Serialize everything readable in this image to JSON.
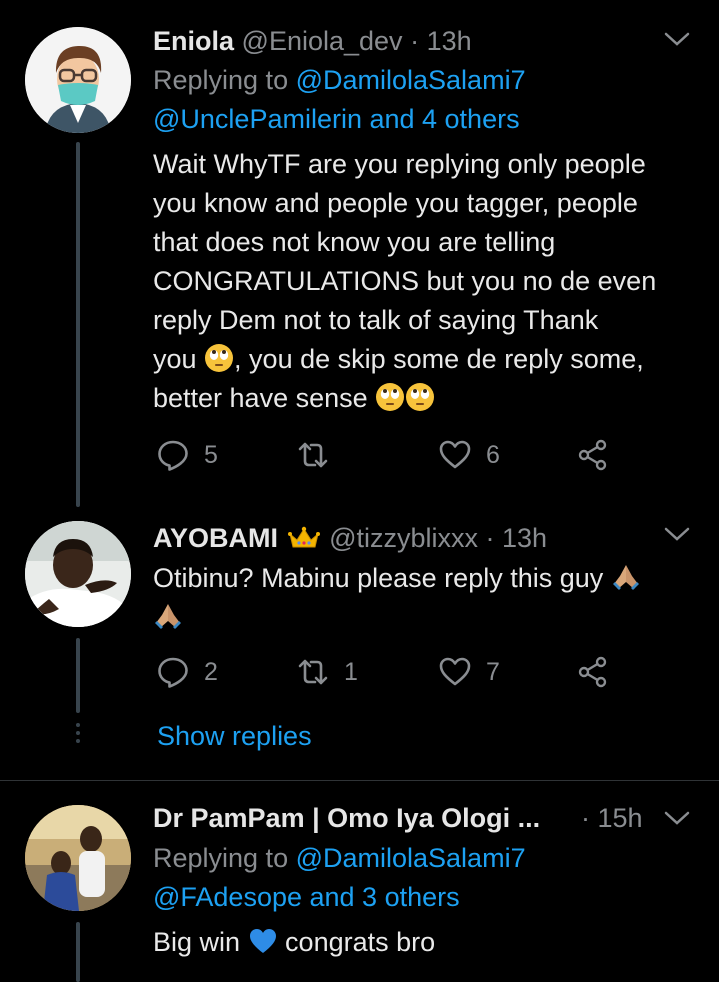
{
  "tweets": [
    {
      "name": "Eniola",
      "handle": "@Eniola_dev",
      "sep": "·",
      "time": "13h",
      "replying_prefix": "Replying to ",
      "replying_user": "@DamilolaSalami7",
      "replying_line2": "@UnclePamilerin and 4 others",
      "lines": [
        "Wait WhyTF are you replying only people",
        "you know and people you tagger, people",
        "that does not know you are telling",
        "CONGRATULATIONS but you no de even",
        "reply Dem not to talk of saying Thank"
      ],
      "line6a": "you ",
      "line6b": ", you de skip some de reply some,",
      "line7": "better have sense ",
      "replies": "5",
      "retweets": "",
      "likes": "6"
    },
    {
      "name": "AYOBAMI",
      "handle": "@tizzyblixxx",
      "sep": "·",
      "time": "13h",
      "text": "Otibinu? Mabinu please reply this guy ",
      "replies": "2",
      "retweets": "1",
      "likes": "7",
      "show_replies": "Show replies"
    },
    {
      "name": "Dr PamPam | Omo Iya Ologi ...",
      "sep": "·",
      "time": "15h",
      "replying_prefix": "Replying to ",
      "replying_user": "@DamilolaSalami7",
      "replying_line2": "@FAdesope and 3 others",
      "text_a": "Big win ",
      "text_b": " congrats bro"
    }
  ],
  "icons": {
    "reply": "reply-icon",
    "retweet": "retweet-icon",
    "like": "heart-icon",
    "share": "share-icon",
    "caret": "chevron-down-icon",
    "eyeroll": "eye-roll-emoji",
    "pray": "folded-hands-emoji",
    "crown": "crown-emoji",
    "heart": "blue-heart-emoji"
  },
  "colors": {
    "background": "#000000",
    "link": "#1da1f2",
    "muted": "#8a8d91",
    "divider": "#2f3336"
  }
}
